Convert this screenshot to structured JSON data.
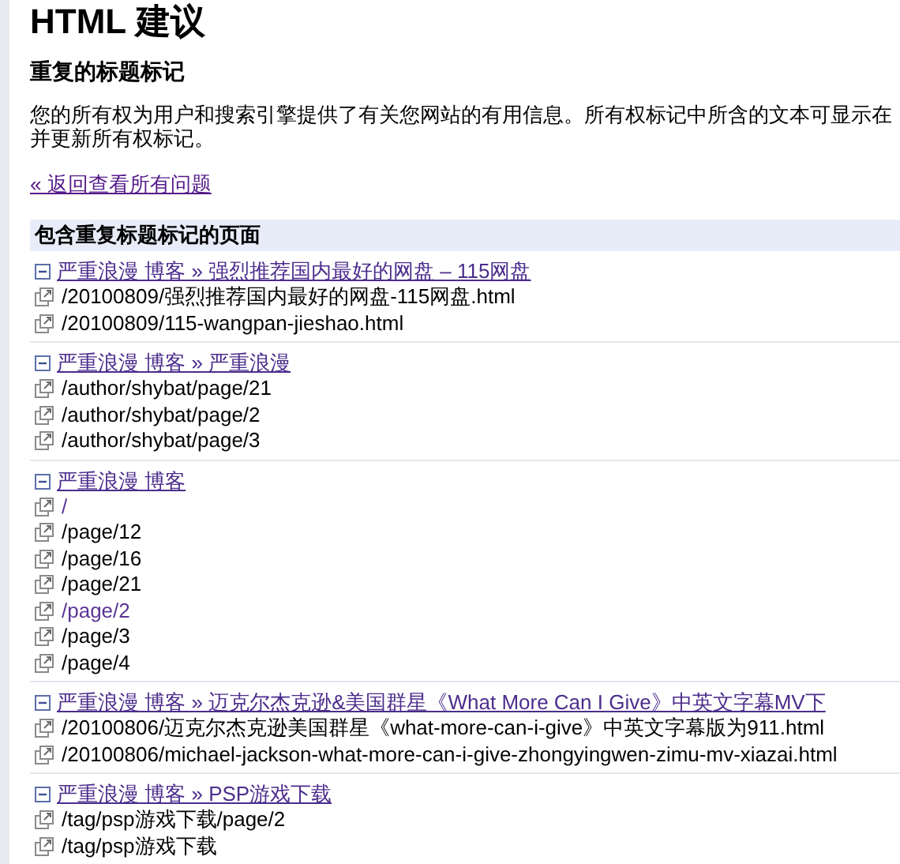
{
  "title": "HTML 建议",
  "subtitle": "重复的标题标记",
  "description_lines": [
    "您的所有权为用户和搜索引擎提供了有关您网站的有用信息。所有权标记中所含的文本可显示在",
    "并更新所有权标记。"
  ],
  "back_link": {
    "text": "« 返回查看所有问题",
    "visited": true
  },
  "section_header": "包含重复标题标记的页面",
  "groups": [
    {
      "title": "严重浪漫  博客  » 强烈推荐国内最好的网盘 – 115网盘",
      "expanded": true,
      "visited": true,
      "pages": [
        {
          "path": "/20100809/强烈推荐国内最好的网盘-115网盘.html",
          "visited": false
        },
        {
          "path": "/20100809/115-wangpan-jieshao.html",
          "visited": false
        }
      ]
    },
    {
      "title": "严重浪漫  博客  » 严重浪漫",
      "expanded": true,
      "visited": true,
      "pages": [
        {
          "path": "/author/shybat/page/21",
          "visited": false
        },
        {
          "path": "/author/shybat/page/2",
          "visited": false
        },
        {
          "path": "/author/shybat/page/3",
          "visited": false
        }
      ]
    },
    {
      "title": "严重浪漫  博客",
      "expanded": true,
      "visited": true,
      "pages": [
        {
          "path": "/",
          "visited": true
        },
        {
          "path": "/page/12",
          "visited": false
        },
        {
          "path": "/page/16",
          "visited": false
        },
        {
          "path": "/page/21",
          "visited": false
        },
        {
          "path": "/page/2",
          "visited": true
        },
        {
          "path": "/page/3",
          "visited": false
        },
        {
          "path": "/page/4",
          "visited": false
        }
      ]
    },
    {
      "title": "严重浪漫  博客  » 迈克尔杰克逊&美国群星《What More Can I Give》中英文字幕MV下",
      "expanded": true,
      "visited": true,
      "pages": [
        {
          "path": "/20100806/迈克尔杰克逊美国群星《what-more-can-i-give》中英文字幕版为911.html",
          "visited": false
        },
        {
          "path": "/20100806/michael-jackson-what-more-can-i-give-zhongyingwen-zimu-mv-xiazai.html",
          "visited": false
        }
      ]
    },
    {
      "title": "严重浪漫  博客  » PSP游戏下载",
      "expanded": true,
      "visited": true,
      "pages": [
        {
          "path": "/tag/psp游戏下载/page/2",
          "visited": false
        },
        {
          "path": "/tag/psp游戏下载",
          "visited": false
        }
      ]
    }
  ]
}
